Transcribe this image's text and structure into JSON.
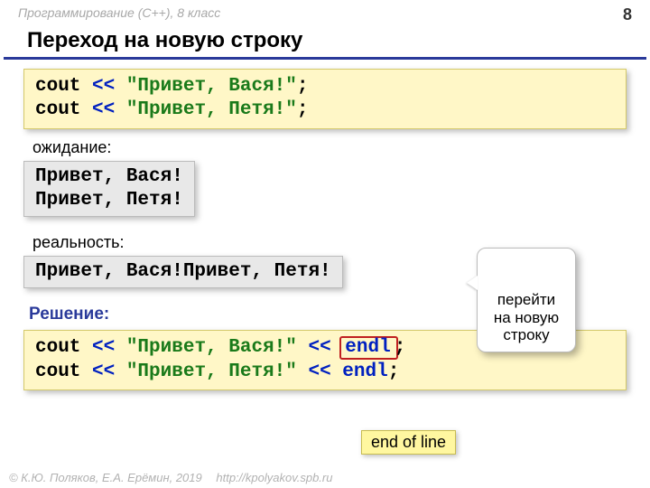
{
  "header": {
    "course": "Программирование (C++), 8 класс",
    "page_number": "8"
  },
  "title": "Переход на новую строку",
  "code1": {
    "l1": {
      "kw": "cout ",
      "op": "<< ",
      "str": "\"Привет, Вася!\"",
      "semi": ";"
    },
    "l2": {
      "kw": "cout ",
      "op": "<< ",
      "str": "\"Привет, Петя!\"",
      "semi": ";"
    }
  },
  "labels": {
    "expectation": "ожидание:",
    "reality": "реальность:",
    "solution": "Решение:"
  },
  "out_expect": {
    "l1": "Привет, Вася!",
    "l2": "Привет, Петя!"
  },
  "out_real": "Привет, Вася!Привет, Петя!",
  "code2": {
    "l1": {
      "kw": "cout ",
      "op1": "<< ",
      "str": "\"Привет, Вася!\" ",
      "op2": "<< ",
      "endl": "endl",
      "semi": ";"
    },
    "l2": {
      "kw": "cout ",
      "op1": "<< ",
      "str": "\"Привет, Петя!\" ",
      "op2": "<< ",
      "endl": "endl",
      "semi": ";"
    }
  },
  "callouts": {
    "newline": "перейти\nна новую\nстроку",
    "eol": "end of line"
  },
  "footer": {
    "copyright": "© К.Ю. Поляков, Е.А. Ерёмин, 2019",
    "url": "http://kpolyakov.spb.ru"
  }
}
